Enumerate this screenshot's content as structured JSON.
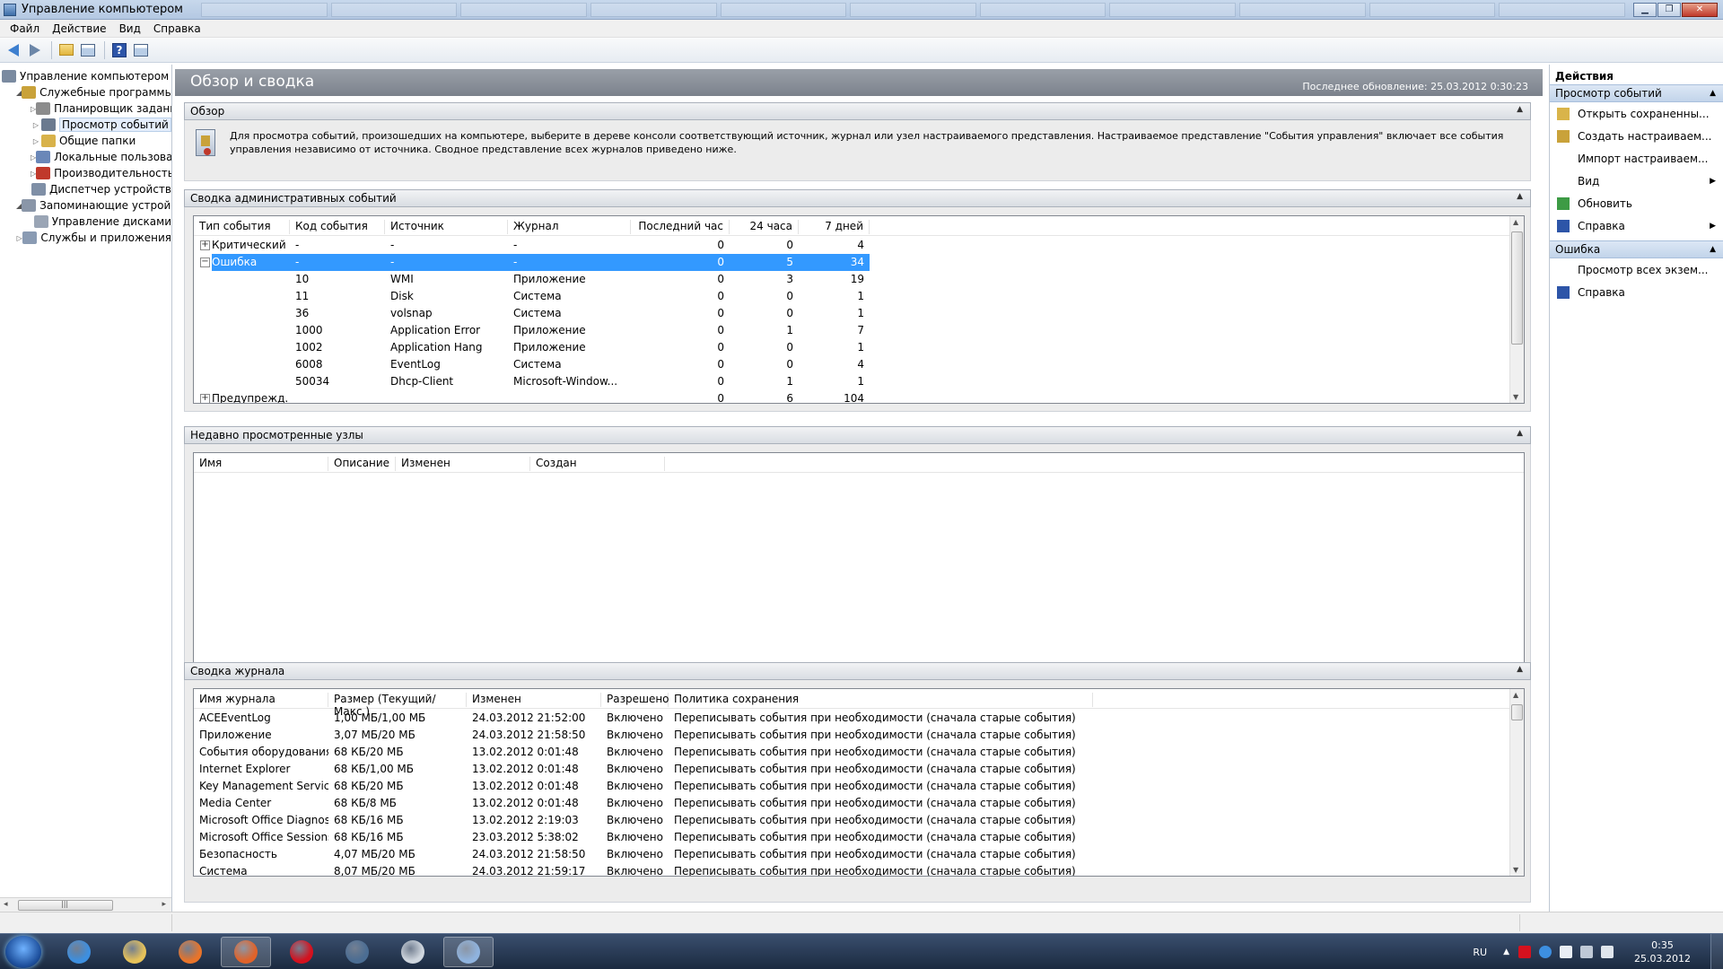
{
  "window": {
    "title": "Управление компьютером"
  },
  "menu": [
    "Файл",
    "Действие",
    "Вид",
    "Справка"
  ],
  "tree": {
    "items": [
      {
        "label": "Управление компьютером (л",
        "indent": 0,
        "twisty": "",
        "color": "#7a8aa0"
      },
      {
        "label": "Служебные программы",
        "indent": 1,
        "twisty": "◢",
        "color": "#c9a23a"
      },
      {
        "label": "Планировщик заданий",
        "indent": 2,
        "twisty": "▷",
        "color": "#8c8c8c"
      },
      {
        "label": "Просмотр событий",
        "indent": 2,
        "twisty": "▷",
        "color": "#6b7a8f",
        "selected": true
      },
      {
        "label": "Общие папки",
        "indent": 2,
        "twisty": "▷",
        "color": "#d8b24a"
      },
      {
        "label": "Локальные пользовате",
        "indent": 2,
        "twisty": "▷",
        "color": "#6a87b8"
      },
      {
        "label": "Производительность",
        "indent": 2,
        "twisty": "▷",
        "color": "#c0392b"
      },
      {
        "label": "Диспетчер устройств",
        "indent": 2,
        "twisty": "",
        "color": "#7f8fa6"
      },
      {
        "label": "Запоминающие устройст",
        "indent": 1,
        "twisty": "◢",
        "color": "#8a96a8"
      },
      {
        "label": "Управление дисками",
        "indent": 2,
        "twisty": "",
        "color": "#9aa5b5"
      },
      {
        "label": "Службы и приложения",
        "indent": 1,
        "twisty": "▷",
        "color": "#8a9bb3"
      }
    ],
    "scroll_left": "◂",
    "scroll_right": "▸",
    "scroll_grip": "|||"
  },
  "header": {
    "title": "Обзор и сводка",
    "last_update": "Последнее обновление: 25.03.2012 0:30:23"
  },
  "overview": {
    "title": "Обзор",
    "text": "Для просмотра событий, произошедших на компьютере, выберите в дереве консоли соответствующий источник, журнал или узел настраиваемого представления. Настраиваемое представление \"События управления\" включает все события управления независимо от источника. Сводное представление всех журналов приведено ниже."
  },
  "admin_summary": {
    "title": "Сводка административных событий",
    "columns": [
      "Тип события",
      "Код события",
      "Источник",
      "Журнал",
      "Последний час",
      "24 часа",
      "7 дней"
    ],
    "rows": [
      {
        "type": "Критический",
        "code": "-",
        "source": "-",
        "log": "-",
        "hour": "0",
        "day": "0",
        "week": "4",
        "expander": "+"
      },
      {
        "type": "Ошибка",
        "code": "-",
        "source": "-",
        "log": "-",
        "hour": "0",
        "day": "5",
        "week": "34",
        "expander": "−",
        "selected": true
      },
      {
        "type": "",
        "code": "10",
        "source": "WMI",
        "log": "Приложение",
        "hour": "0",
        "day": "3",
        "week": "19"
      },
      {
        "type": "",
        "code": "11",
        "source": "Disk",
        "log": "Система",
        "hour": "0",
        "day": "0",
        "week": "1"
      },
      {
        "type": "",
        "code": "36",
        "source": "volsnap",
        "log": "Система",
        "hour": "0",
        "day": "0",
        "week": "1"
      },
      {
        "type": "",
        "code": "1000",
        "source": "Application Error",
        "log": "Приложение",
        "hour": "0",
        "day": "1",
        "week": "7"
      },
      {
        "type": "",
        "code": "1002",
        "source": "Application Hang",
        "log": "Приложение",
        "hour": "0",
        "day": "0",
        "week": "1"
      },
      {
        "type": "",
        "code": "6008",
        "source": "EventLog",
        "log": "Система",
        "hour": "0",
        "day": "0",
        "week": "4"
      },
      {
        "type": "",
        "code": "50034",
        "source": "Dhcp-Client",
        "log": "Microsoft-Window...",
        "hour": "0",
        "day": "1",
        "week": "1"
      },
      {
        "type": "Предупрежд...",
        "code": "",
        "source": "",
        "log": "",
        "hour": "0",
        "day": "6",
        "week": "104",
        "expander": "+"
      }
    ]
  },
  "recent_nodes": {
    "title": "Недавно просмотренные узлы",
    "columns": [
      "Имя",
      "Описание",
      "Изменен",
      "Создан"
    ]
  },
  "log_summary": {
    "title": "Сводка журнала",
    "columns": [
      "Имя журнала",
      "Размер (Текущий/Макс.)",
      "Изменен",
      "Разрешено",
      "Политика сохранения"
    ],
    "rows": [
      {
        "name": "ACEEventLog",
        "size": "1,00 МБ/1,00 МБ",
        "modified": "24.03.2012 21:52:00",
        "enabled": "Включено",
        "policy": "Переписывать события при необходимости (сначала старые события)"
      },
      {
        "name": "Приложение",
        "size": "3,07 МБ/20 МБ",
        "modified": "24.03.2012 21:58:50",
        "enabled": "Включено",
        "policy": "Переписывать события при необходимости (сначала старые события)"
      },
      {
        "name": "События оборудования",
        "size": "68 КБ/20 МБ",
        "modified": "13.02.2012 0:01:48",
        "enabled": "Включено",
        "policy": "Переписывать события при необходимости (сначала старые события)"
      },
      {
        "name": "Internet Explorer",
        "size": "68 КБ/1,00 МБ",
        "modified": "13.02.2012 0:01:48",
        "enabled": "Включено",
        "policy": "Переписывать события при необходимости (сначала старые события)"
      },
      {
        "name": "Key Management Service",
        "size": "68 КБ/20 МБ",
        "modified": "13.02.2012 0:01:48",
        "enabled": "Включено",
        "policy": "Переписывать события при необходимости (сначала старые события)"
      },
      {
        "name": "Media Center",
        "size": "68 КБ/8 МБ",
        "modified": "13.02.2012 0:01:48",
        "enabled": "Включено",
        "policy": "Переписывать события при необходимости (сначала старые события)"
      },
      {
        "name": "Microsoft Office Diagnos...",
        "size": "68 КБ/16 МБ",
        "modified": "13.02.2012 2:19:03",
        "enabled": "Включено",
        "policy": "Переписывать события при необходимости (сначала старые события)"
      },
      {
        "name": "Microsoft Office Sessions",
        "size": "68 КБ/16 МБ",
        "modified": "23.03.2012 5:38:02",
        "enabled": "Включено",
        "policy": "Переписывать события при необходимости (сначала старые события)"
      },
      {
        "name": "Безопасность",
        "size": "4,07 МБ/20 МБ",
        "modified": "24.03.2012 21:58:50",
        "enabled": "Включено",
        "policy": "Переписывать события при необходимости (сначала старые события)"
      },
      {
        "name": "Система",
        "size": "8,07 МБ/20 МБ",
        "modified": "24.03.2012 21:59:17",
        "enabled": "Включено",
        "policy": "Переписывать события при необходимости (сначала старые события)"
      }
    ]
  },
  "actions": {
    "title": "Действия",
    "groups": [
      {
        "label": "Просмотр событий",
        "caret": "▲",
        "items": [
          {
            "label": "Открыть сохраненны...",
            "icon": "open-saved-log-icon",
            "color": "#d9b44a"
          },
          {
            "label": "Создать настраиваем...",
            "icon": "filter-icon",
            "color": "#c9a23a"
          },
          {
            "label": "Импорт настраиваем...",
            "icon": "",
            "color": ""
          },
          {
            "label": "Вид",
            "icon": "",
            "color": "",
            "submenu": "▶"
          },
          {
            "label": "Обновить",
            "icon": "refresh-icon",
            "color": "#3d9b45"
          },
          {
            "label": "Справка",
            "icon": "help-icon",
            "color": "#2d55a8",
            "submenu": "▶"
          }
        ]
      },
      {
        "label": "Ошибка",
        "caret": "▲",
        "items": [
          {
            "label": "Просмотр всех экзем...",
            "icon": "",
            "color": ""
          },
          {
            "label": "Справка",
            "icon": "help-icon",
            "color": "#2d55a8"
          }
        ]
      }
    ]
  },
  "taskbar": {
    "apps": [
      {
        "name": "internet-explorer",
        "color": "#3d8fe0",
        "active": false
      },
      {
        "name": "file-explorer",
        "color": "#e6c25a",
        "active": false
      },
      {
        "name": "media-player",
        "color": "#e8742a",
        "active": false
      },
      {
        "name": "firefox",
        "color": "#e0632a",
        "active": true
      },
      {
        "name": "opera",
        "color": "#d4111e",
        "active": false
      },
      {
        "name": "steam",
        "color": "#4b6d93",
        "active": false
      },
      {
        "name": "clock-app",
        "color": "#cfd6de",
        "active": false
      },
      {
        "name": "computer-management",
        "color": "#8fb3de",
        "active": true
      }
    ],
    "lang": "RU",
    "time": "0:35",
    "date": "25.03.2012"
  }
}
